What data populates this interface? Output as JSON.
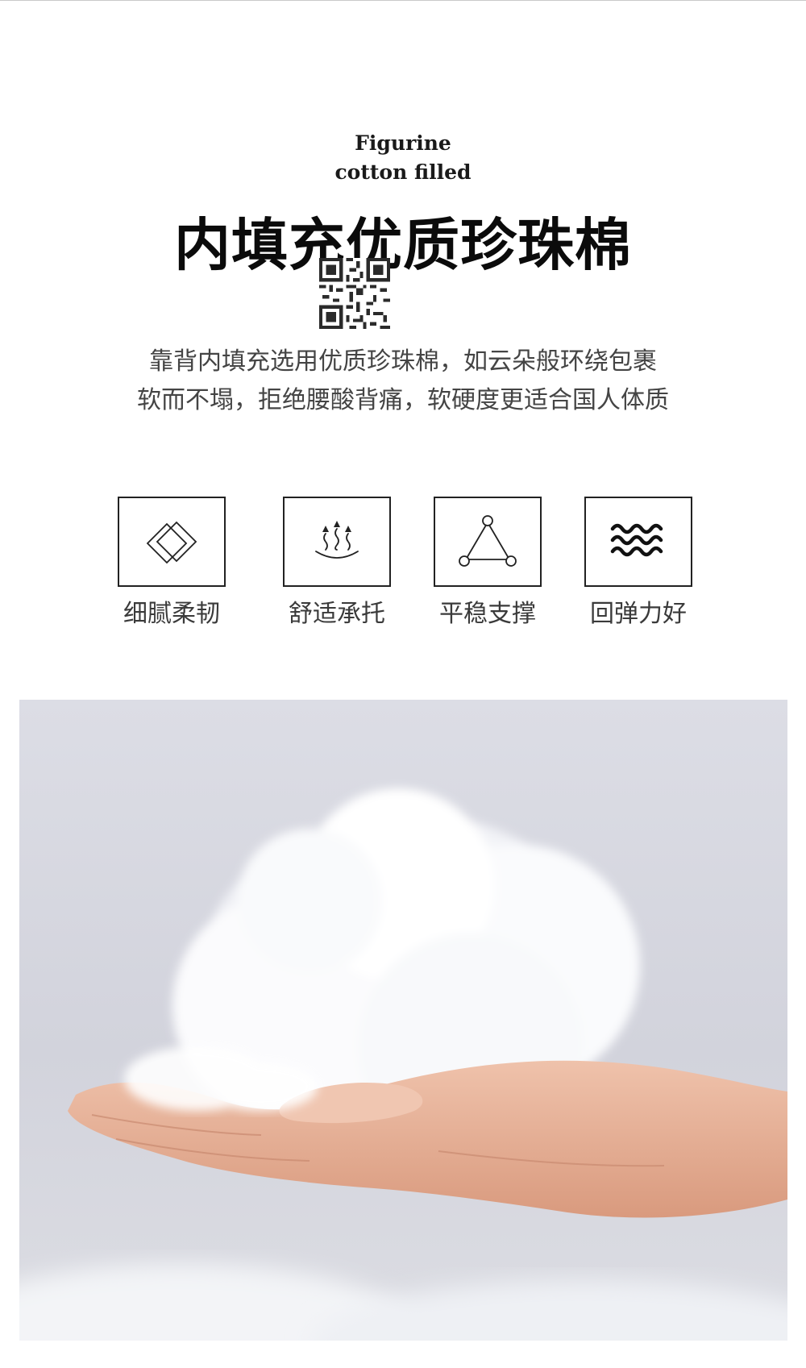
{
  "header": {
    "en_title_line1": "Figurine",
    "en_title_line2": "cotton filled",
    "cn_title": "内填充优质珍珠棉"
  },
  "description": {
    "line1": "靠背内填充选用优质珍珠棉，如云朵般环绕包裹",
    "line2": "软而不塌，拒绝腰酸背痛，软硬度更适合国人体质"
  },
  "features": [
    {
      "icon": "diamond-icon",
      "label": "细腻柔韧"
    },
    {
      "icon": "heat-arrows-icon",
      "label": "舒适承托"
    },
    {
      "icon": "triangle-nodes-icon",
      "label": "平稳支撑"
    },
    {
      "icon": "waves-icon",
      "label": "回弹力好"
    }
  ],
  "photo": {
    "subject": "hand-holding-cotton-filling"
  }
}
